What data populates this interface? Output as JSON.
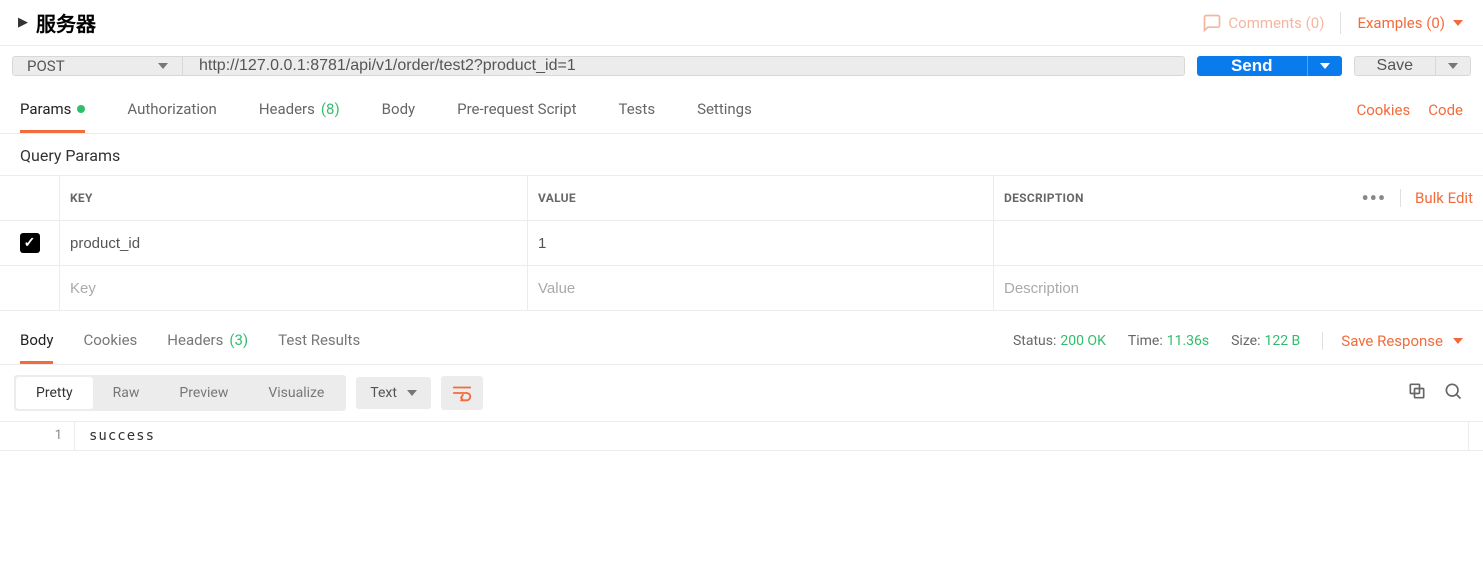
{
  "header": {
    "title": "服务器",
    "comments_label": "Comments (0)",
    "examples_label": "Examples (0)"
  },
  "request": {
    "method": "POST",
    "url": "http://127.0.0.1:8781/api/v1/order/test2?product_id=1",
    "send_label": "Send",
    "save_label": "Save"
  },
  "req_tabs": {
    "params": "Params",
    "authorization": "Authorization",
    "headers": "Headers",
    "headers_count": "(8)",
    "body": "Body",
    "prerequest": "Pre-request Script",
    "tests": "Tests",
    "settings": "Settings",
    "cookies_link": "Cookies",
    "code_link": "Code"
  },
  "params_section": {
    "title": "Query Params",
    "head_key": "KEY",
    "head_value": "VALUE",
    "head_desc": "DESCRIPTION",
    "bulk_edit": "Bulk Edit",
    "rows": [
      {
        "key": "product_id",
        "value": "1",
        "desc": ""
      }
    ],
    "placeholder_key": "Key",
    "placeholder_value": "Value",
    "placeholder_desc": "Description"
  },
  "resp_tabs": {
    "body": "Body",
    "cookies": "Cookies",
    "headers": "Headers",
    "headers_count": "(3)",
    "test_results": "Test Results"
  },
  "resp_stats": {
    "status_label": "Status:",
    "status_val": "200 OK",
    "time_label": "Time:",
    "time_val": "11.36s",
    "size_label": "Size:",
    "size_val": "122 B",
    "save_response": "Save Response"
  },
  "body_toolbar": {
    "pretty": "Pretty",
    "raw": "Raw",
    "preview": "Preview",
    "visualize": "Visualize",
    "format": "Text"
  },
  "response_body": {
    "line_num": "1",
    "content": "success"
  }
}
